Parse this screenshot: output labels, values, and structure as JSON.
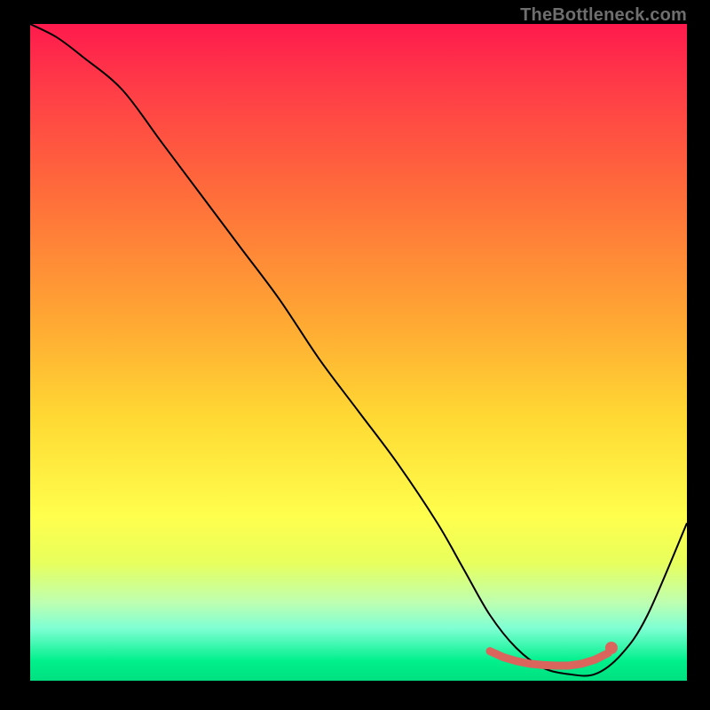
{
  "watermark": "TheBottleneck.com",
  "colors": {
    "curve": "#000000",
    "marker": "#d9655d",
    "gradient_top": "#ff1a4d",
    "gradient_bottom": "#00e080",
    "background": "#000000"
  },
  "chart_data": {
    "type": "line",
    "title": "",
    "xlabel": "",
    "ylabel": "",
    "xlim": [
      0,
      100
    ],
    "ylim": [
      0,
      100
    ],
    "grid": false,
    "legend": false,
    "series": [
      {
        "name": "bottleneck-curve",
        "x": [
          0,
          4,
          8,
          14,
          20,
          26,
          32,
          38,
          44,
          50,
          56,
          62,
          66,
          70,
          74,
          78,
          82,
          86,
          90,
          94,
          100
        ],
        "y": [
          100,
          98,
          95,
          90,
          82,
          74,
          66,
          58,
          49,
          41,
          33,
          24,
          17,
          10,
          5,
          2,
          1,
          1,
          4,
          10,
          24
        ]
      }
    ],
    "markers": {
      "name": "optimal-zone",
      "style": "filled-circle",
      "color": "#d9655d",
      "x": [
        70,
        72,
        74,
        76,
        78,
        80,
        82,
        84,
        86,
        88
      ],
      "y": [
        4.5,
        3.6,
        3.0,
        2.6,
        2.4,
        2.3,
        2.3,
        2.6,
        3.2,
        4.2
      ]
    }
  }
}
